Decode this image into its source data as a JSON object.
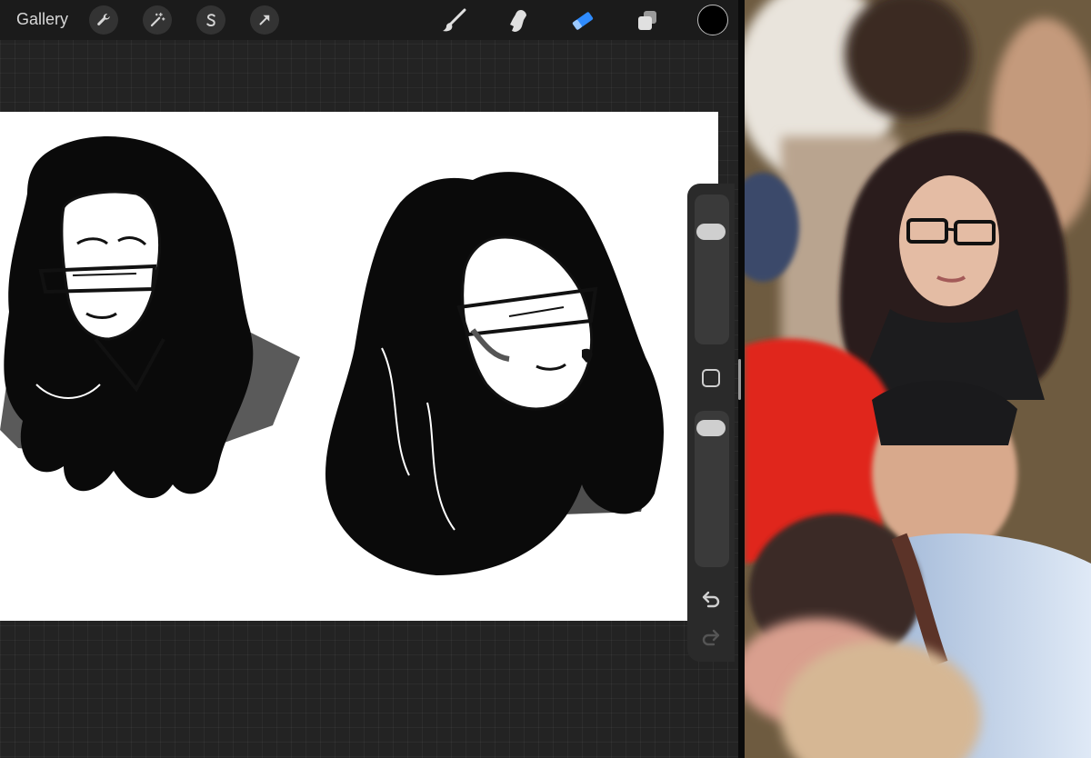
{
  "toolbar": {
    "gallery_label": "Gallery",
    "left_buttons": [
      "wrench-icon",
      "magic-wand-icon",
      "selection-icon",
      "transform-arrow-icon"
    ],
    "tools": [
      "brush-icon",
      "smudge-icon",
      "eraser-icon",
      "layers-icon"
    ],
    "active_tool": "eraser-icon",
    "active_tool_color": "#2f8cff",
    "current_color": "#000000"
  },
  "sidebar": {
    "brush_size_level": 0.9,
    "opacity_level": 0.95,
    "buttons": [
      "modify-button",
      "undo-icon",
      "redo-icon"
    ]
  },
  "photo": {
    "description_icon": "reference-photo"
  }
}
